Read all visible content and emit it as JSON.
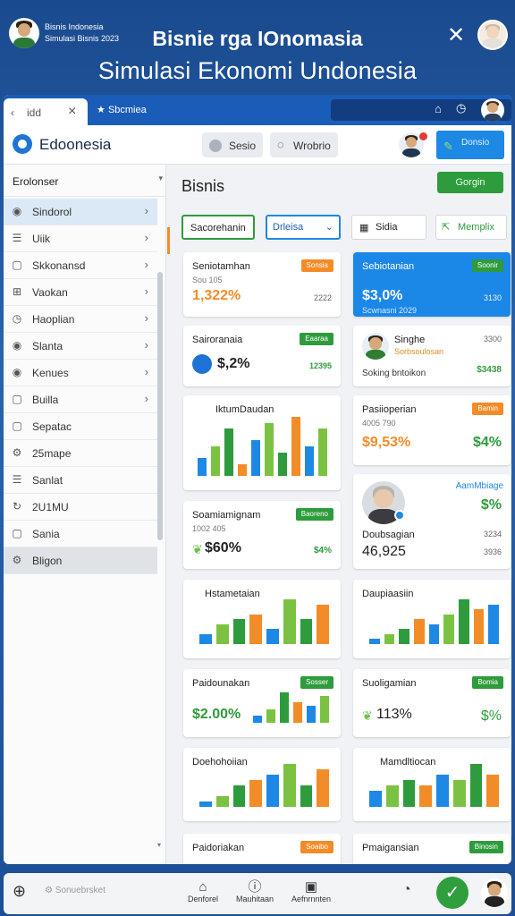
{
  "top": {
    "profile_line1": "Bisnis Indonesia",
    "profile_line2": "Simulasi Bisnis 2023",
    "title": "Bisnie rga IOnomasia",
    "subtitle": "Simulasi Ekonomi Undonesia",
    "close_icon": "close-icon"
  },
  "tabbar": {
    "tab1_label": "idd",
    "tab2_label": "Sbcmiea"
  },
  "header": {
    "app_name": "Edoonesia",
    "pill1": "Sesio",
    "pill2": "Wrobrio",
    "badge": "Donsio"
  },
  "sidebar": {
    "title": "Erolonser",
    "items": [
      {
        "label": "Sindorol",
        "icon": "circle-icon"
      },
      {
        "label": "Uiik",
        "icon": "list-icon"
      },
      {
        "label": "Skkonansd",
        "icon": "doc-icon"
      },
      {
        "label": "Vaokan",
        "icon": "grid-icon"
      },
      {
        "label": "Haoplian",
        "icon": "clock-icon"
      },
      {
        "label": "Slanta",
        "icon": "circle-icon"
      },
      {
        "label": "Kenues",
        "icon": "circle-icon"
      },
      {
        "label": "Builla",
        "icon": "doc-icon"
      },
      {
        "label": "Sepatac",
        "icon": "doc-icon"
      },
      {
        "label": "25mape",
        "icon": "gear-icon"
      },
      {
        "label": "Sanlat",
        "icon": "list-icon"
      },
      {
        "label": "2U1MU",
        "icon": "refresh-icon"
      },
      {
        "label": "Sania",
        "icon": "doc-icon"
      },
      {
        "label": "Bligon",
        "icon": "gear-icon"
      }
    ]
  },
  "main": {
    "title": "Bisnis",
    "action": "Gorgin",
    "filters": [
      "Sacorehanin",
      "Drleisa",
      "Sidia",
      "Memplix"
    ]
  },
  "cards": [
    {
      "title": "Seniotamhan",
      "sub": "Sou 105",
      "value": "1,322%",
      "note": "2222",
      "tag": "Sonsia"
    },
    {
      "title": "Sebiotanian",
      "sub": "Scwnasni 2029",
      "value": "$3,0%",
      "note": "3130",
      "tag": "Soonir"
    },
    {
      "title": "Sairoranaia",
      "value": "$,2%",
      "note": "12395",
      "tag": "Eaaraa"
    },
    {
      "title": "Singhe",
      "sub": "Sorbsoulosan",
      "value": "Soking bntoikon",
      "note": "3300",
      "note2": "$3438"
    },
    {
      "title": "IktumDaudan",
      "chart": [
        3,
        5,
        8,
        2,
        6,
        9,
        4,
        10,
        5,
        8
      ]
    },
    {
      "title": "Pasiioperian",
      "sub": "4005 790",
      "value": "$9,53%",
      "note": "$4%",
      "tag": "Bamin"
    },
    {
      "title": "Soamiamignam",
      "sub": "1002 405",
      "value": "$60%",
      "note": "$4%",
      "tag": "Baoreno"
    },
    {
      "title": "AamMbiage",
      "sub": "Doubsagian",
      "value": "$%",
      "note": "3234",
      "value2": "46,925",
      "note2": "3936"
    },
    {
      "title": "Hstametaian",
      "chart": [
        2,
        4,
        5,
        6,
        3,
        9,
        5,
        8
      ]
    },
    {
      "title": "Daupiaasiin",
      "chart": [
        1,
        2,
        3,
        5,
        4,
        6,
        9,
        7,
        8
      ]
    },
    {
      "title": "Paidounakan",
      "value": "$2.00%",
      "tag": "Sosser",
      "chart": [
        2,
        4,
        9,
        6,
        5,
        8
      ]
    },
    {
      "title": "Suoligamian",
      "value": "113%",
      "note": "$%",
      "tag": "Bomia"
    },
    {
      "title": "Doehohoiian",
      "chart": [
        1,
        2,
        4,
        5,
        6,
        8,
        4,
        7
      ]
    },
    {
      "title": "Mamdltiocan",
      "chart": [
        3,
        4,
        5,
        4,
        6,
        5,
        8,
        6
      ]
    },
    {
      "title": "Paidoriakan",
      "tag": "Soaibo"
    },
    {
      "title": "Pmaigansian",
      "tag": "Binosin"
    }
  ],
  "colors": {
    "accent": "#1e88e5",
    "green": "#2e9b3c",
    "orange": "#f28c28",
    "blue_card": "#1b87e6"
  },
  "bottom": {
    "search": "Sonuebrsket",
    "items": [
      "Denforel",
      "Mauhitaan",
      "Aefnrnnten"
    ]
  }
}
